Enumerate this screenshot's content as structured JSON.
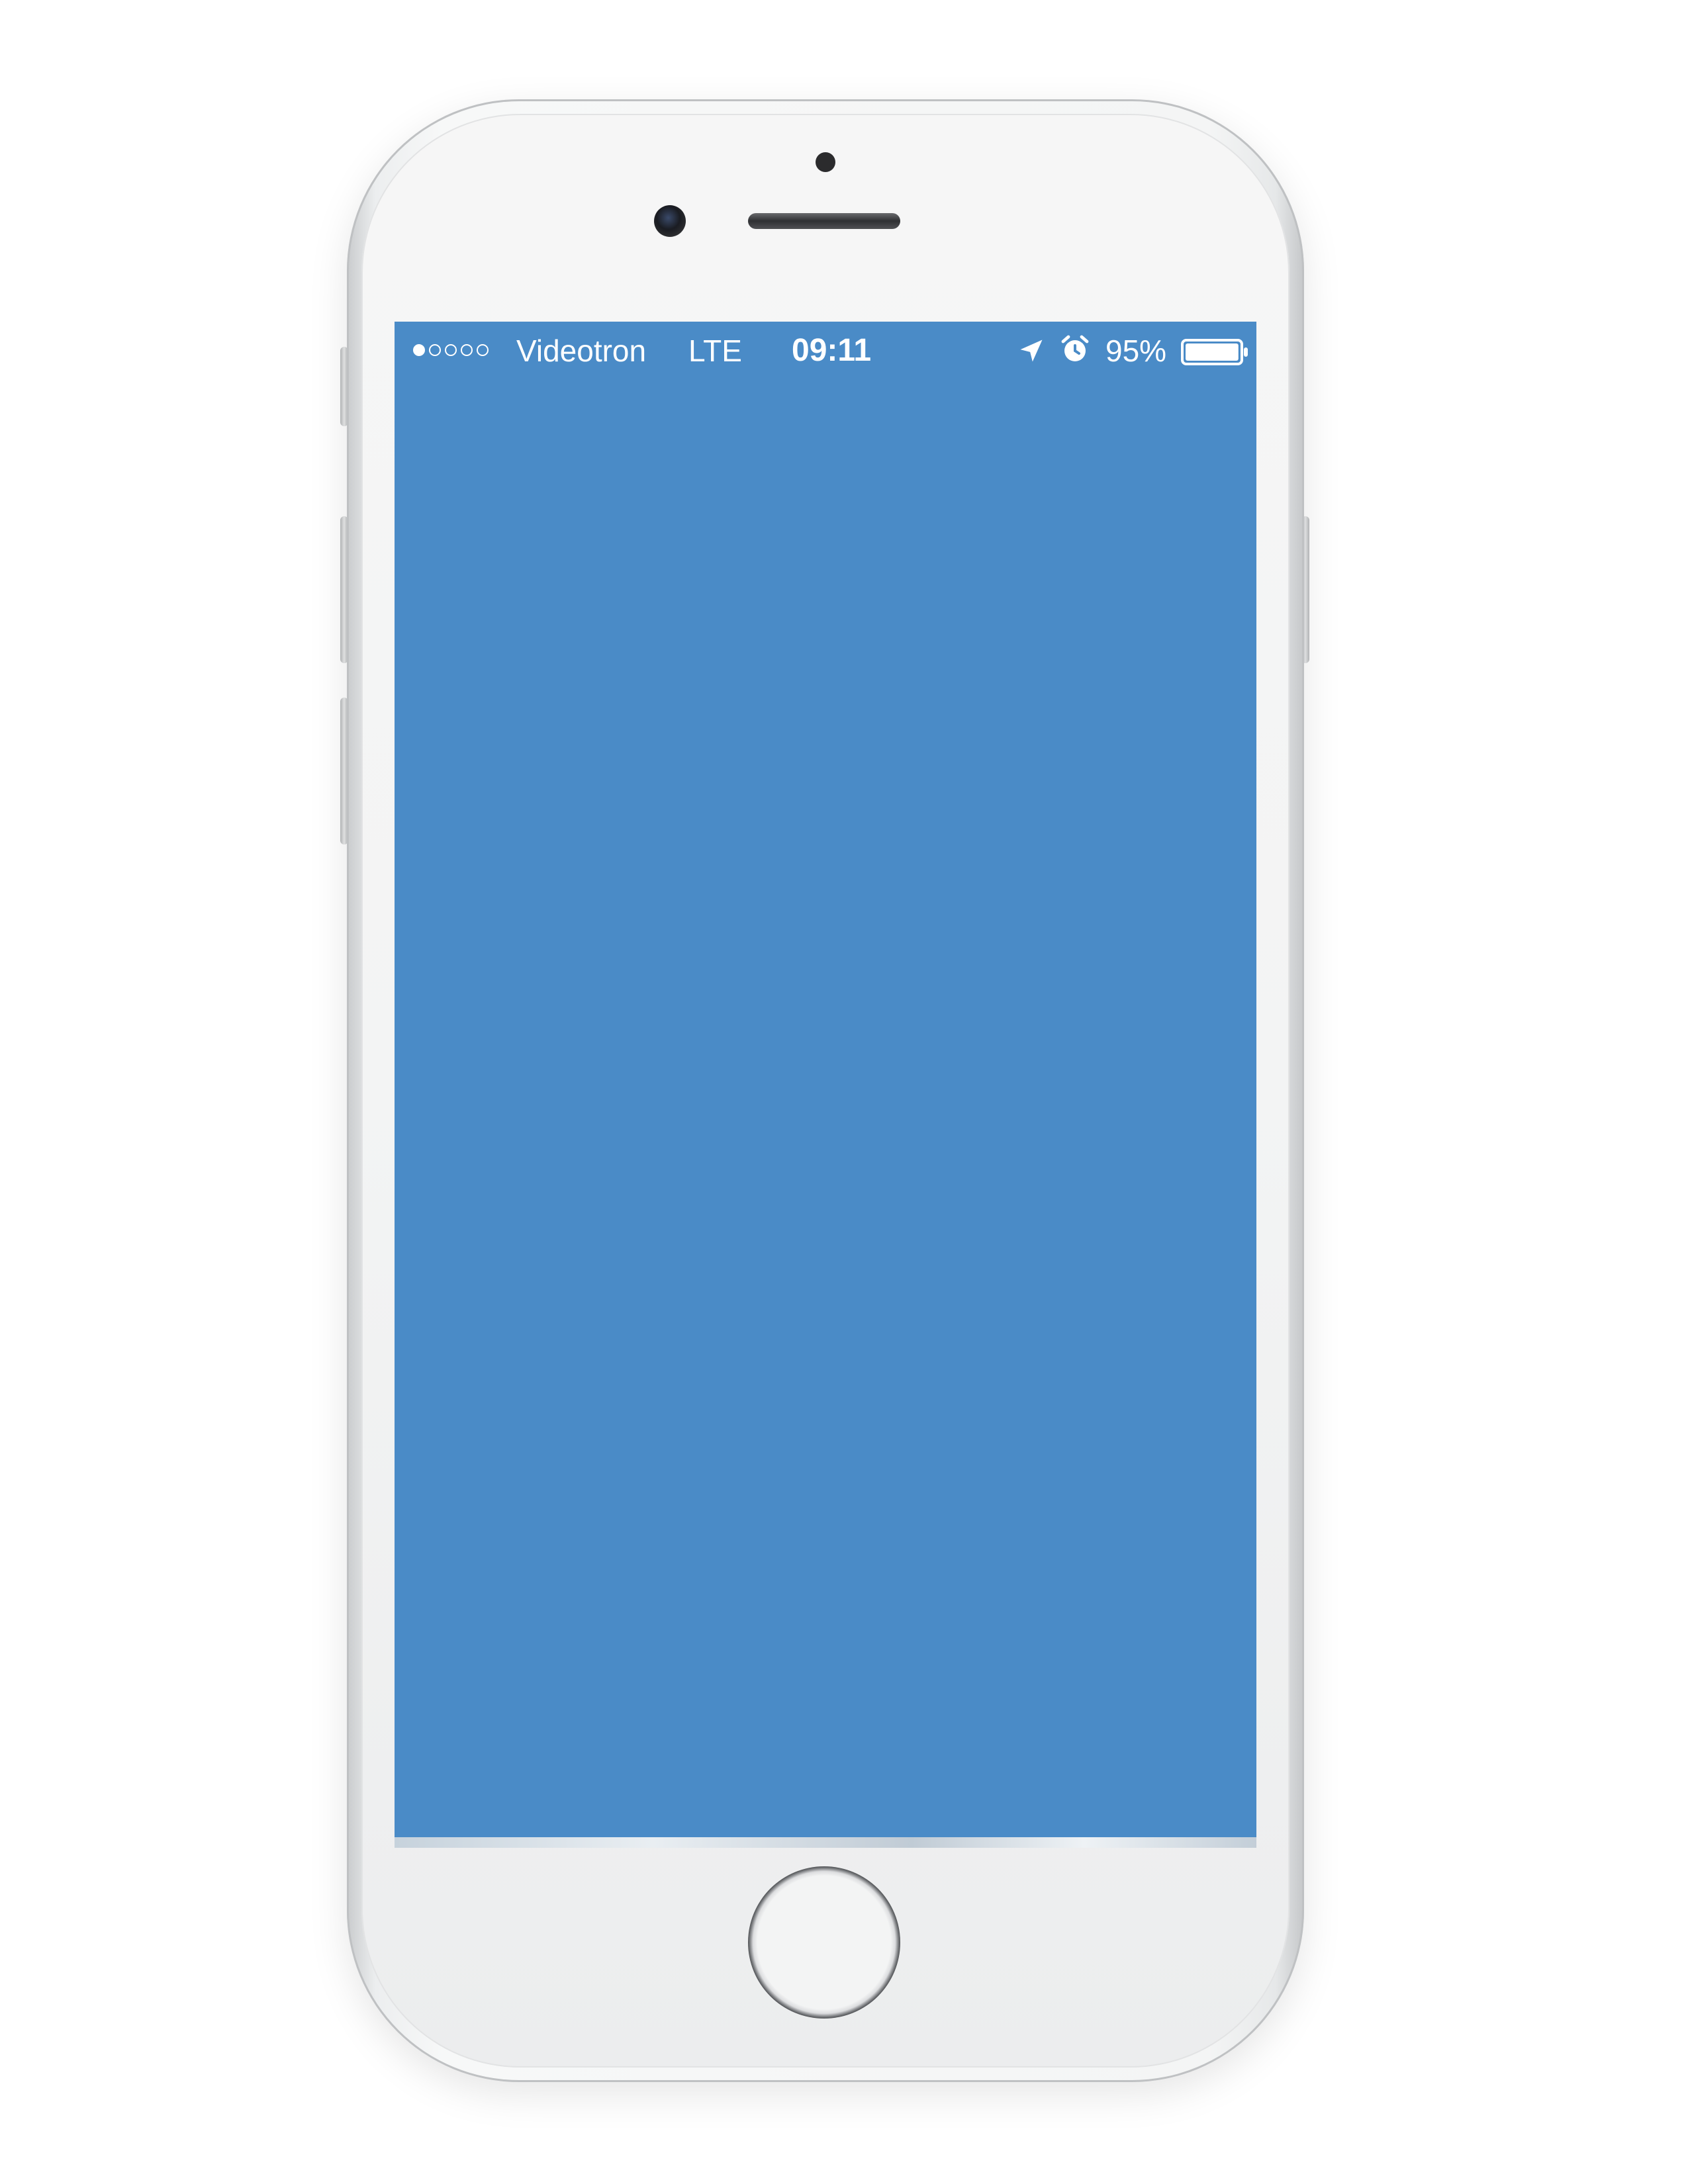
{
  "device": {
    "model_hint": "white smartphone mockup",
    "colors": {
      "screen_background": "#4a8bc7",
      "status_text": "#ffffff",
      "body": "#f4f5f5"
    }
  },
  "status_bar": {
    "signal_strength": {
      "filled": 1,
      "total": 5
    },
    "carrier": "Videotron",
    "network": "LTE",
    "time": "09:11",
    "icons": [
      "location-arrow-icon",
      "alarm-clock-icon"
    ],
    "battery_percent_label": "95%",
    "battery_level": 0.95
  }
}
